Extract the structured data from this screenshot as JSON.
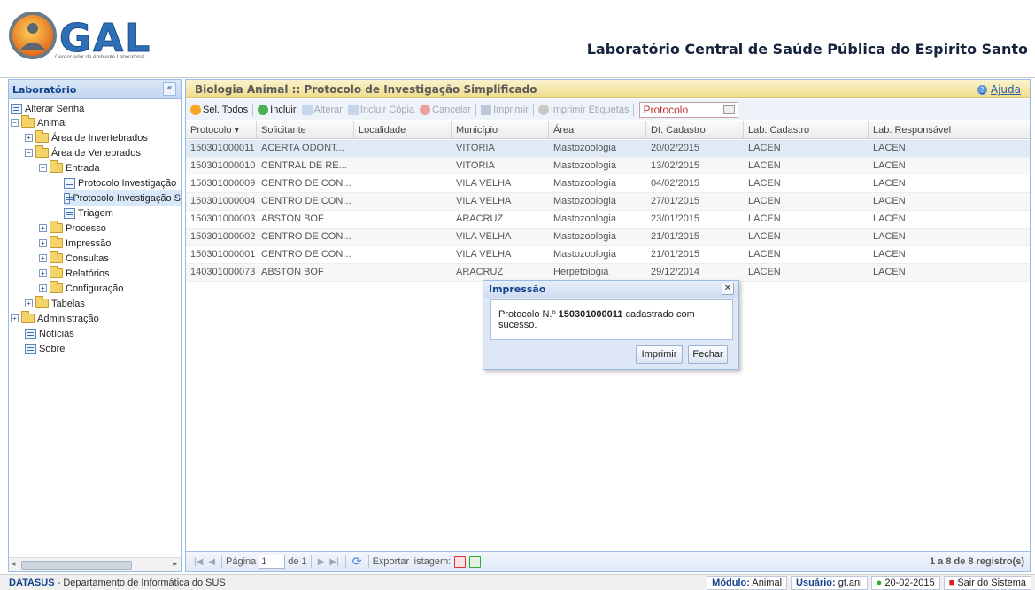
{
  "header": {
    "logo_text": "GAL",
    "logo_tagline": "Gerenciador de Ambiente Laboratorial",
    "title": "Laboratório Central de Saúde Pública do Espirito Santo"
  },
  "sidebar": {
    "title": "Laboratório",
    "collapse": "«",
    "tree": [
      {
        "label": "Alterar Senha"
      },
      {
        "label": "Animal"
      },
      {
        "label": "Área de Invertebrados"
      },
      {
        "label": "Área de Vertebrados"
      },
      {
        "label": "Entrada"
      },
      {
        "label": "Protocolo Investigação"
      },
      {
        "label": "Protocolo Investigação S"
      },
      {
        "label": "Triagem"
      },
      {
        "label": "Processo"
      },
      {
        "label": "Impressão"
      },
      {
        "label": "Consultas"
      },
      {
        "label": "Relatórios"
      },
      {
        "label": "Configuração"
      },
      {
        "label": "Tabelas"
      },
      {
        "label": "Administração"
      },
      {
        "label": "Notícias"
      },
      {
        "label": "Sobre"
      }
    ]
  },
  "main": {
    "title": "Biologia Animal :: Protocolo de Investigação Simplificado",
    "help": "Ajuda",
    "toolbar": {
      "select_all": "Sel. Todos",
      "include": "Incluir",
      "edit": "Alterar",
      "include_copy": "Incluir Cópia",
      "cancel": "Cancelar",
      "print": "Imprimir",
      "print_labels": "Imprimir Etiquetas",
      "protocol_placeholder": "Protocolo"
    },
    "columns": [
      "Protocolo ▾",
      "Solicitante",
      "Localidade",
      "Município",
      "Área",
      "Dt. Cadastro",
      "Lab. Cadastro",
      "Lab. Responsável"
    ],
    "rows": [
      [
        "150301000011",
        "ACERTA ODONT...",
        "",
        "VITORIA",
        "Mastozoologia",
        "20/02/2015",
        "LACEN",
        "LACEN"
      ],
      [
        "150301000010",
        "CENTRAL DE RE...",
        "",
        "VITORIA",
        "Mastozoologia",
        "13/02/2015",
        "LACEN",
        "LACEN"
      ],
      [
        "150301000009",
        "CENTRO DE CON...",
        "",
        "VILA VELHA",
        "Mastozoologia",
        "04/02/2015",
        "LACEN",
        "LACEN"
      ],
      [
        "150301000004",
        "CENTRO DE CON...",
        "",
        "VILA VELHA",
        "Mastozoologia",
        "27/01/2015",
        "LACEN",
        "LACEN"
      ],
      [
        "150301000003",
        "ABSTON BOF",
        "",
        "ARACRUZ",
        "Mastozoologia",
        "23/01/2015",
        "LACEN",
        "LACEN"
      ],
      [
        "150301000002",
        "CENTRO DE CON...",
        "",
        "VILA VELHA",
        "Mastozoologia",
        "21/01/2015",
        "LACEN",
        "LACEN"
      ],
      [
        "150301000001",
        "CENTRO DE CON...",
        "",
        "VILA VELHA",
        "Mastozoologia",
        "21/01/2015",
        "LACEN",
        "LACEN"
      ],
      [
        "140301000073",
        "ABSTON BOF",
        "",
        "ARACRUZ",
        "Herpetologia",
        "29/12/2014",
        "LACEN",
        "LACEN"
      ]
    ],
    "pager": {
      "page_label": "Página",
      "page_value": "1",
      "of_label": "de 1",
      "export_label": "Exportar listagem:",
      "count": "1 a 8 de 8 registro(s)"
    }
  },
  "dialog": {
    "title": "Impressão",
    "close": "✕",
    "message_prefix": "Protocolo N.º",
    "protocol": "150301000011",
    "message_suffix": "cadastrado com sucesso.",
    "print_button": "Imprimir",
    "close_button": "Fechar"
  },
  "footer": {
    "org_abbr": "DATASUS",
    "org_name": " - Departamento de Informática do SUS",
    "module_label": "Módulo:",
    "module_value": "Animal",
    "user_label": "Usuário:",
    "user_value": "gt.ani",
    "date": "20-02-2015",
    "logout": "Sair do Sistema"
  },
  "colors": {
    "accent": "#15428b",
    "panel_border": "#99bbe8",
    "title_bar": "#f0dc8a",
    "protocol_text": "#c03030"
  }
}
